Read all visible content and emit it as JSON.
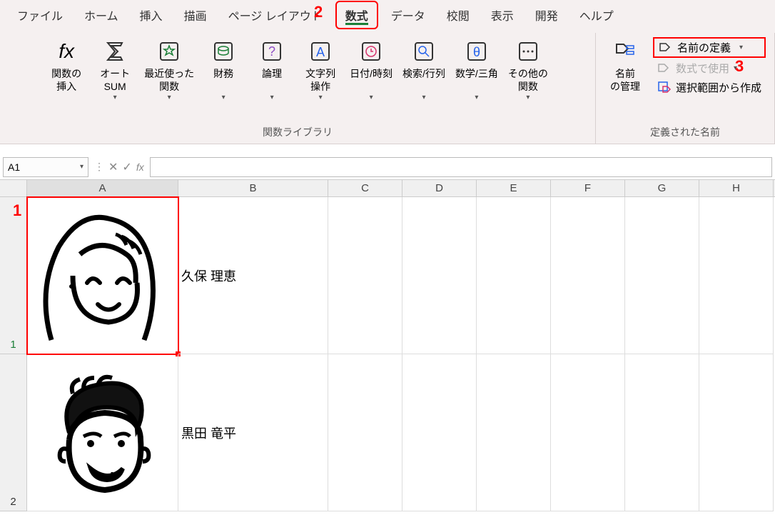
{
  "tabs": [
    {
      "label": "ファイル"
    },
    {
      "label": "ホーム"
    },
    {
      "label": "挿入"
    },
    {
      "label": "描画"
    },
    {
      "label": "ページ レイアウト"
    },
    {
      "label": "数式",
      "active": true
    },
    {
      "label": "データ"
    },
    {
      "label": "校閲"
    },
    {
      "label": "表示"
    },
    {
      "label": "開発"
    },
    {
      "label": "ヘルプ"
    }
  ],
  "ribbon": {
    "lib_group_label": "関数ライブラリ",
    "names_group_label": "定義された名前",
    "insert_fn": {
      "label": "関数の\n挿入",
      "symbol": "fx"
    },
    "autosum": "オート\nSUM",
    "recent": "最近使った\n関数",
    "financial": "財務",
    "logical": "論理",
    "text": "文字列\n操作",
    "datetime": "日付/時刻",
    "lookup": "検索/行列",
    "mathtrig": "数学/三角",
    "morefn": "その他の\n関数",
    "name_mgr": "名前\nの管理",
    "define_name": "名前の定義",
    "use_in_formula": "数式で使用",
    "create_from_sel": "選択範囲から作成"
  },
  "formula_bar": {
    "name_box_value": "A1",
    "fx_label": "fx",
    "formula_value": ""
  },
  "columns": [
    "A",
    "B",
    "C",
    "D",
    "E",
    "F",
    "G",
    "H"
  ],
  "rows": [
    {
      "num": "1",
      "b_value": "久保 理恵",
      "selected": true
    },
    {
      "num": "2",
      "b_value": "黒田 竜平"
    }
  ],
  "callouts": {
    "c1": "1",
    "c2": "2",
    "c3": "3"
  }
}
